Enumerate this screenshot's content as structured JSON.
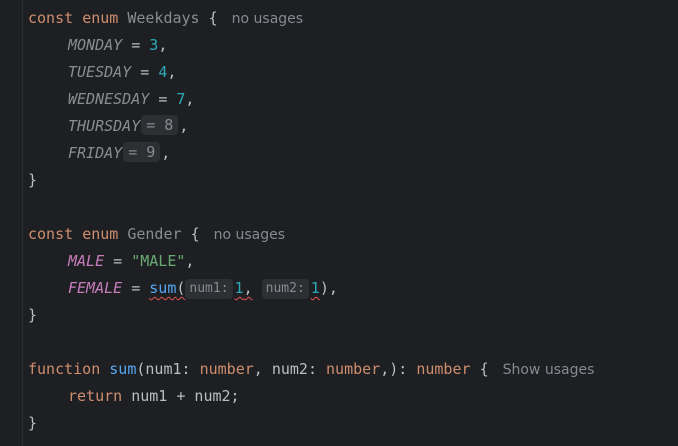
{
  "enum1": {
    "line1": {
      "const": "const",
      "enum": "enum",
      "name": "Weekdays",
      "brace": "{",
      "usage": "no usages"
    },
    "members": [
      {
        "name": "MONDAY",
        "eq": "=",
        "value": "3",
        "comma": ","
      },
      {
        "name": "TUESDAY",
        "eq": "=",
        "value": "4",
        "comma": ","
      },
      {
        "name": "WEDNESDAY",
        "eq": "=",
        "value": "7",
        "comma": ","
      },
      {
        "name": "THURSDAY",
        "hint": "= 8",
        "comma": ","
      },
      {
        "name": "FRIDAY",
        "hint": "= 9",
        "comma": ","
      }
    ],
    "close": "}"
  },
  "enum2": {
    "line1": {
      "const": "const",
      "enum": "enum",
      "name": "Gender",
      "brace": "{",
      "usage": "no usages"
    },
    "male": {
      "name": "MALE",
      "eq": "=",
      "value": "\"MALE\"",
      "comma": ","
    },
    "female": {
      "name": "FEMALE",
      "eq": "=",
      "fn": "sum",
      "open": "(",
      "p1_hint": "num1:",
      "p1_val": "1",
      "sep": ",",
      "p2_hint": "num2:",
      "p2_val": "1",
      "close": "),"
    },
    "close": "}"
  },
  "func": {
    "kw": "function",
    "name": "sum",
    "open": "(",
    "p1": "num1",
    "colon1": ":",
    "t1": "number",
    "comma1": ",",
    "p2": "num2",
    "colon2": ":",
    "t2": "number",
    "tail": ",):",
    "ret_type": "number",
    "brace": "{",
    "usage": "Show usages",
    "body_kw": "return",
    "body_expr": "num1 + num2;",
    "close": "}"
  }
}
